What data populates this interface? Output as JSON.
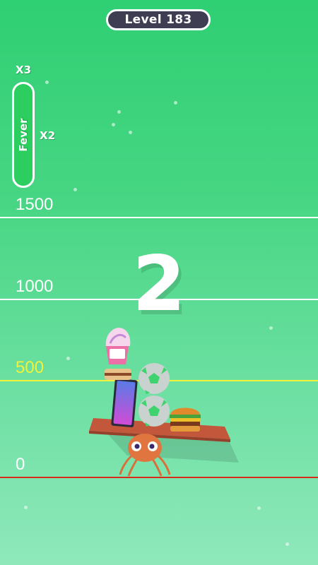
{
  "header": {
    "level_label": "Level 183"
  },
  "fever": {
    "label": "Fever",
    "upper_multiplier": "X3",
    "middle_multiplier": "X2",
    "fill_fraction": 1.0,
    "fill_color": "#2ccf5f"
  },
  "score_lines": [
    {
      "label": "1500",
      "color": "#ffffff"
    },
    {
      "label": "1000",
      "color": "#ffffff"
    },
    {
      "label": "500",
      "color": "#f2f23a"
    },
    {
      "label": "0",
      "color": "#ffffff",
      "line_color": "#d92a1c"
    }
  ],
  "countdown": {
    "value": "2"
  },
  "colors": {
    "background_top": "#2fcf73",
    "background_bottom": "#8fe8bb",
    "pill_bg": "#3f3d52"
  }
}
